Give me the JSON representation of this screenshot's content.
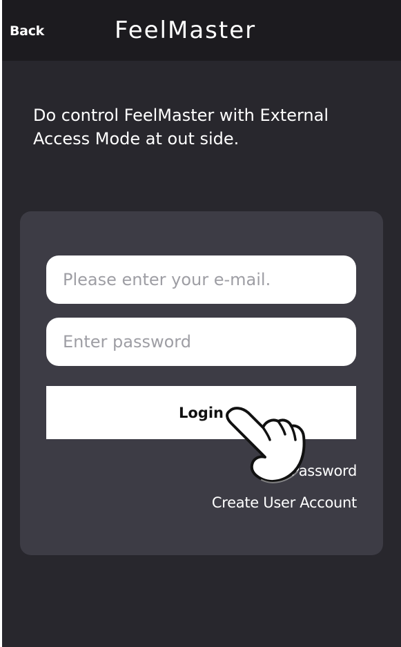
{
  "header": {
    "back_label": "Back",
    "title": "FeelMaster"
  },
  "intro_text": "Do control FeelMaster with External Access Mode at out side.",
  "login_form": {
    "email_placeholder": "Please enter your e-mail.",
    "password_placeholder": "Enter password",
    "login_label": "Login",
    "find_password_label": "Find Password",
    "create_account_label": "Create User Account"
  },
  "overlay": {
    "pointer_icon": "tap-hand-icon"
  },
  "colors": {
    "background": "#28272d",
    "header_background": "#1c1b1f",
    "panel_background": "#3d3c45",
    "field_background": "#ffffff",
    "text_primary": "#ffffff"
  }
}
